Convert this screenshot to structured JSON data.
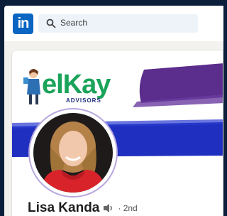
{
  "header": {
    "logo_text": "in",
    "search_placeholder": "Search"
  },
  "banner": {
    "brand_text": "elKay",
    "brand_subtitle": "ADVISORS"
  },
  "profile": {
    "name": "Lisa Kanda",
    "degree": "· 2nd"
  },
  "colors": {
    "linkedin_blue": "#0a66c2",
    "brand_green": "#1aa35a",
    "banner_purple": "#5b2d8c",
    "banner_blue": "#1f2fbf"
  }
}
